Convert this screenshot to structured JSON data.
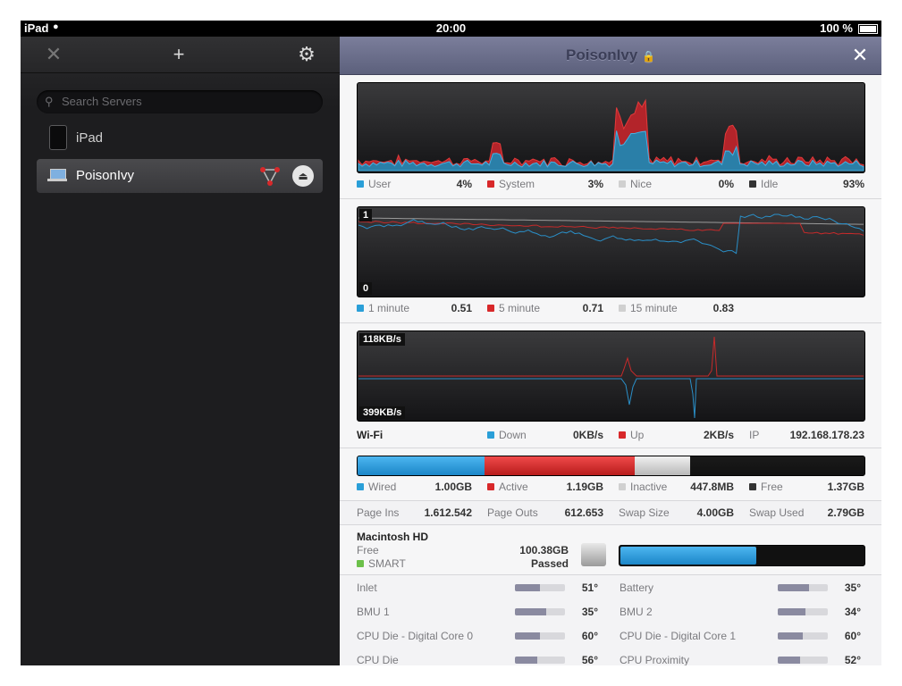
{
  "status": {
    "carrier": "iPad",
    "time": "20:00",
    "battery": "100 %"
  },
  "sidebar": {
    "search_placeholder": "Search Servers",
    "servers": [
      {
        "label": "iPad"
      },
      {
        "label": "PoisonIvy",
        "selected": true
      }
    ]
  },
  "panel": {
    "title": "PoisonIvy"
  },
  "cpu": {
    "items": [
      {
        "label": "User",
        "value": "4%",
        "color": "#2a9fd8"
      },
      {
        "label": "System",
        "value": "3%",
        "color": "#d8282a"
      },
      {
        "label": "Nice",
        "value": "0%",
        "color": "#d0d0d0"
      },
      {
        "label": "Idle",
        "value": "93%",
        "color": "#333333"
      }
    ]
  },
  "load": {
    "max_label": "1",
    "min_label": "0",
    "items": [
      {
        "label": "1 minute",
        "value": "0.51",
        "color": "#2a9fd8"
      },
      {
        "label": "5 minute",
        "value": "0.71",
        "color": "#d8282a"
      },
      {
        "label": "15 minute",
        "value": "0.83",
        "color": "#d0d0d0"
      }
    ]
  },
  "network": {
    "top_label": "118KB/s",
    "bottom_label": "399KB/s",
    "interface": "Wi-Fi",
    "down_label": "Down",
    "down_value": "0KB/s",
    "up_label": "Up",
    "up_value": "2KB/s",
    "ip_label": "IP",
    "ip_value": "192.168.178.23"
  },
  "memory": {
    "items": [
      {
        "label": "Wired",
        "value": "1.00GB",
        "color": "#2a9fd8",
        "fraction": 0.25
      },
      {
        "label": "Active",
        "value": "1.19GB",
        "color": "#d8282a",
        "fraction": 0.296
      },
      {
        "label": "Inactive",
        "value": "447.8MB",
        "color": "#d0d0d0",
        "fraction": 0.109
      },
      {
        "label": "Free",
        "value": "1.37GB",
        "color": "#333333",
        "fraction": 0.345
      }
    ],
    "stats": [
      {
        "label": "Page Ins",
        "value": "1.612.542"
      },
      {
        "label": "Page Outs",
        "value": "612.653"
      },
      {
        "label": "Swap Size",
        "value": "4.00GB"
      },
      {
        "label": "Swap Used",
        "value": "2.79GB"
      }
    ]
  },
  "disk": {
    "name": "Macintosh HD",
    "free_label": "Free",
    "free_value": "100.38GB",
    "smart_label": "SMART",
    "smart_value": "Passed",
    "smart_color": "#6cc04a",
    "used_fraction": 0.56
  },
  "sensors": [
    {
      "left": {
        "label": "Inlet",
        "value": "51°",
        "fraction": 0.5
      },
      "right": {
        "label": "Battery",
        "value": "35°",
        "fraction": 0.62
      }
    },
    {
      "left": {
        "label": "BMU 1",
        "value": "35°",
        "fraction": 0.62
      },
      "right": {
        "label": "BMU 2",
        "value": "34°",
        "fraction": 0.55
      }
    },
    {
      "left": {
        "label": "CPU Die - Digital Core 0",
        "value": "60°",
        "fraction": 0.5
      },
      "right": {
        "label": "CPU Die - Digital Core 1",
        "value": "60°",
        "fraction": 0.5
      }
    },
    {
      "left": {
        "label": "CPU Die",
        "value": "56°",
        "fraction": 0.45
      },
      "right": {
        "label": "CPU Proximity",
        "value": "52°",
        "fraction": 0.45
      }
    }
  ]
}
